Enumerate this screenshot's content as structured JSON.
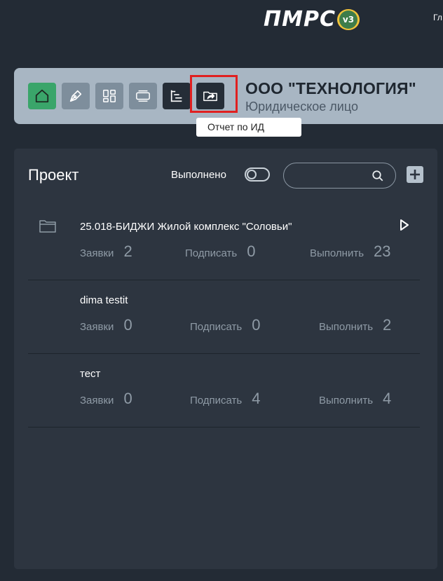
{
  "topbar": {
    "logo_text": "ПМРС",
    "logo_version": "v3",
    "right_text": "Гл"
  },
  "header": {
    "company_name": "ООО \"ТЕХНОЛОГИЯ\"",
    "company_type": "Юридическое лицо",
    "toolbar": [
      {
        "icon": "home-icon"
      },
      {
        "icon": "pen-icon"
      },
      {
        "icon": "dashboard-icon"
      },
      {
        "icon": "layers-icon"
      },
      {
        "icon": "tree-list-icon"
      },
      {
        "icon": "folder-share-icon"
      }
    ],
    "tooltip": "Отчет по ИД"
  },
  "panel": {
    "title": "Проект",
    "done_label": "Выполнено",
    "search_placeholder": "",
    "projects": [
      {
        "name": "25.018-БИДЖИ Жилой комплекс \"Соловьи\"",
        "has_folder": true,
        "has_play": true,
        "stats": [
          {
            "label": "Заявки",
            "value": "2"
          },
          {
            "label": "Подписать",
            "value": "0"
          },
          {
            "label": "Выполнить",
            "value": "23"
          }
        ]
      },
      {
        "name": "dima testit",
        "has_folder": false,
        "has_play": false,
        "stats": [
          {
            "label": "Заявки",
            "value": "0"
          },
          {
            "label": "Подписать",
            "value": "0"
          },
          {
            "label": "Выполнить",
            "value": "2"
          }
        ]
      },
      {
        "name": "тест",
        "has_folder": false,
        "has_play": false,
        "stats": [
          {
            "label": "Заявки",
            "value": "0"
          },
          {
            "label": "Подписать",
            "value": "4"
          },
          {
            "label": "Выполнить",
            "value": "4"
          }
        ]
      }
    ]
  },
  "colors": {
    "background": "#232b35",
    "header_card": "#a8b6c3",
    "home_button": "#3aa56a",
    "highlight": "#e02020",
    "panel": "#2d3540"
  }
}
